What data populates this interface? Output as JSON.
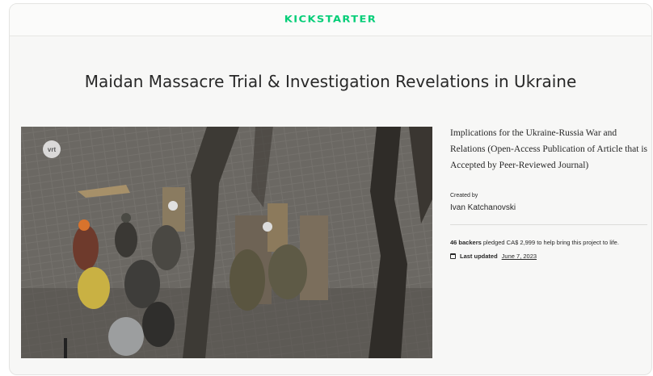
{
  "header": {
    "logo_text": "KICKSTARTER",
    "brand_color": "#05ce78"
  },
  "project": {
    "title": "Maidan Massacre Trial & Investigation Revelations in Ukraine",
    "blurb": "Implications for the Ukraine-Russia War and Relations (Open-Access Publication of Article that is Accepted by Peer-Reviewed Journal)",
    "created_by_label": "Created by",
    "creator_name": "Ivan Katchanovski",
    "backers": "46 backers",
    "pledge_text": "pledged CA$ 2,999 to help bring this project to life.",
    "last_updated_label": "Last updated",
    "last_updated_date": "June 7, 2023"
  },
  "video": {
    "watermark": "vrt"
  },
  "icons": {
    "calendar": "calendar-icon"
  }
}
